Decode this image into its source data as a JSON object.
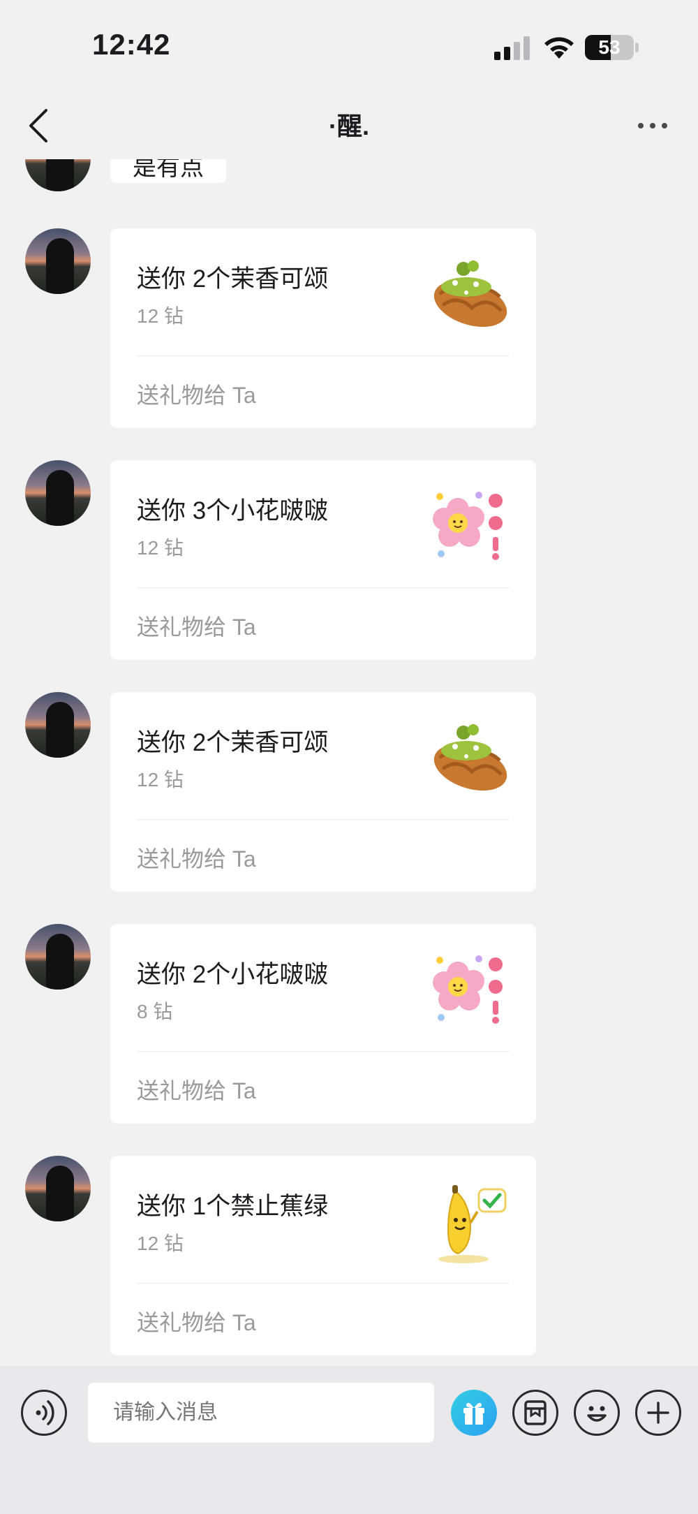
{
  "status_bar": {
    "time": "12:42",
    "battery_level": "53",
    "battery_fraction": 0.53
  },
  "nav": {
    "title": "·醒."
  },
  "partial_message": {
    "text": "是有点"
  },
  "gifts": [
    {
      "title": "送你 2个茉香可颂",
      "price": "12 钻",
      "action": "送礼物给 Ta",
      "icon": "croissant-icon"
    },
    {
      "title": "送你 3个小花啵啵",
      "price": "12 钻",
      "action": "送礼物给 Ta",
      "icon": "flower-icon"
    },
    {
      "title": "送你 2个茉香可颂",
      "price": "12 钻",
      "action": "送礼物给 Ta",
      "icon": "croissant-icon"
    },
    {
      "title": "送你 2个小花啵啵",
      "price": "8 钻",
      "action": "送礼物给 Ta",
      "icon": "flower-icon"
    },
    {
      "title": "送你 1个禁止蕉绿",
      "price": "12 钻",
      "action": "送礼物给 Ta",
      "icon": "banana-icon"
    }
  ],
  "input_bar": {
    "placeholder": "请输入消息"
  }
}
